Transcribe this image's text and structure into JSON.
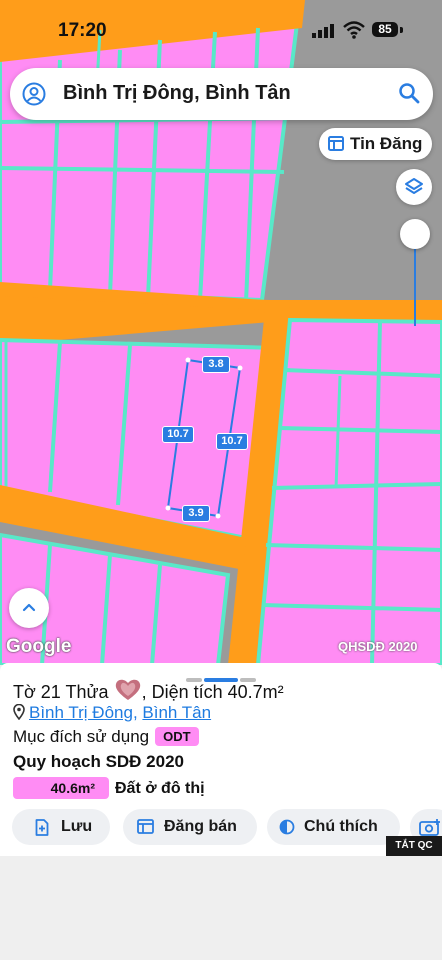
{
  "status_bar": {
    "time": "17:20",
    "battery": "85"
  },
  "search": {
    "query": "Bình Trị Đông, Bình Tân"
  },
  "map": {
    "tin_dang_label": "Tin Đăng",
    "google_label": "Google",
    "layer_label": "QHSDĐ 2020",
    "dimensions": {
      "top": "3.8",
      "left": "10.7",
      "right": "10.7",
      "bottom": "3.9"
    },
    "colors": {
      "parcel": "#ff8cf4",
      "road": "#ff9d1a",
      "border": "#59e8c8",
      "ground": "#9a9a9a"
    }
  },
  "parcel": {
    "title_prefix": "Tờ 21 Thửa",
    "title_suffix": ", Diện tích 40.7m²",
    "ward_link": "Bình Trị Đông",
    "district_link": "Bình Tân",
    "purpose_label": "Mục đích sử dụng",
    "purpose_code": "ODT",
    "plan_title": "Quy hoạch SDĐ 2020",
    "plan_area": "40.6m²",
    "plan_type": "Đất ở đô thị"
  },
  "actions": {
    "save": "Lưu",
    "sell": "Đăng bán",
    "legend": "Chú thích"
  },
  "ad_badge": "TẮT QC"
}
